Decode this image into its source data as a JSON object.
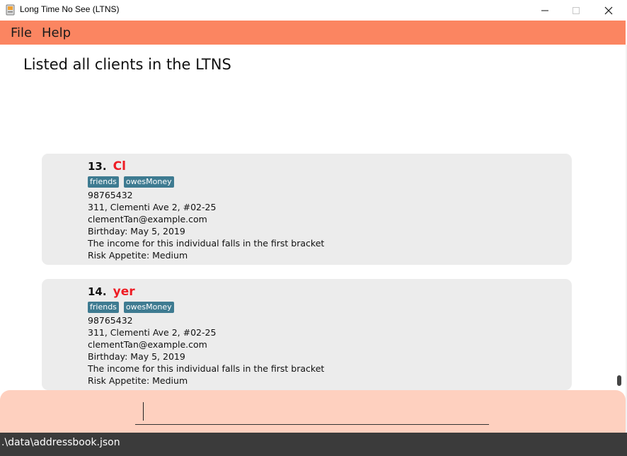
{
  "window": {
    "title": "Long Time No See (LTNS)"
  },
  "menu": {
    "file": "File",
    "help": "Help"
  },
  "result": {
    "message": "Listed all clients in the LTNS"
  },
  "clients": [
    {
      "index": "13.",
      "name": "Cl",
      "tags": [
        "friends",
        "owesMoney"
      ],
      "phone": "98765432",
      "address": "311, Clementi Ave 2, #02-25",
      "email": "clementTan@example.com",
      "birthday": "Birthday: May 5, 2019",
      "income": "The income for this individual falls in the first bracket",
      "risk": "Risk Appetite: Medium"
    },
    {
      "index": "14.",
      "name": "yer",
      "tags": [
        "friends",
        "owesMoney"
      ],
      "phone": "98765432",
      "address": "311, Clementi Ave 2, #02-25",
      "email": "clementTan@example.com",
      "birthday": "Birthday: May 5, 2019",
      "income": "The income for this individual falls in the first bracket",
      "risk": "Risk Appetite: Medium"
    }
  ],
  "command": {
    "value": "",
    "placeholder": ""
  },
  "status": {
    "path": ".\\data\\addressbook.json"
  },
  "colors": {
    "menu_bar": "#fb8561",
    "command_area": "#fed0bf",
    "tag": "#3e7b91",
    "client_name": "#ee1c24",
    "status_bar": "#3b3b3b",
    "card": "#ececec"
  }
}
